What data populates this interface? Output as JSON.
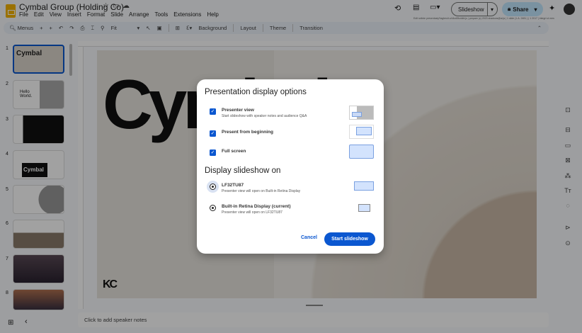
{
  "app": {
    "title": "Cymbal Group (Holding Co)",
    "menu": [
      "File",
      "Edit",
      "View",
      "Insert",
      "Format",
      "Slide",
      "Arrange",
      "Tools",
      "Extensions",
      "Help"
    ],
    "slideshow_label": "Slideshow",
    "share_label": "Share",
    "info_text": "Edit seitnie presentasiy*tagbeuit.c/d4zd5fzddbl.js | prepare (c) 2023 shadows@ai.js | 1 slide (1.A. 2481 ) | 1 2017 | integri ut mes"
  },
  "toolbar": {
    "search": "Menus",
    "zoom": "Fit",
    "background": "Background",
    "layout": "Layout",
    "theme": "Theme",
    "transition": "Transition"
  },
  "slides": [
    {
      "num": "1",
      "text": "Cymbal"
    },
    {
      "num": "2",
      "text": "Hello World."
    },
    {
      "num": "3",
      "text": ""
    },
    {
      "num": "4",
      "text": "Cymbal"
    },
    {
      "num": "5",
      "text": ""
    },
    {
      "num": "6",
      "text": ""
    },
    {
      "num": "7",
      "text": ""
    },
    {
      "num": "8",
      "text": ""
    }
  ],
  "canvas": {
    "headline": "Cymbal",
    "mark": "KC"
  },
  "notes": {
    "placeholder": "Click to add speaker notes"
  },
  "dialog": {
    "title": "Presentation display options",
    "options": [
      {
        "label": "Presenter view",
        "sub": "Start slideshow with speaker notes and audience Q&A",
        "checked": true
      },
      {
        "label": "Present from beginning",
        "sub": "",
        "checked": true
      },
      {
        "label": "Full screen",
        "sub": "",
        "checked": true
      }
    ],
    "display_title": "Display slideshow on",
    "displays": [
      {
        "label": "LF32TU87",
        "sub": "Presenter view will open on Built-in Retina Display",
        "selected": true
      },
      {
        "label": "Built-in Retina Display (current)",
        "sub": "Presenter view will open on LF32TU87",
        "selected": false
      }
    ],
    "cancel": "Cancel",
    "start": "Start slideshow"
  },
  "colors": {
    "accent": "#0b57d0",
    "share_bg": "#c2e7ff"
  }
}
